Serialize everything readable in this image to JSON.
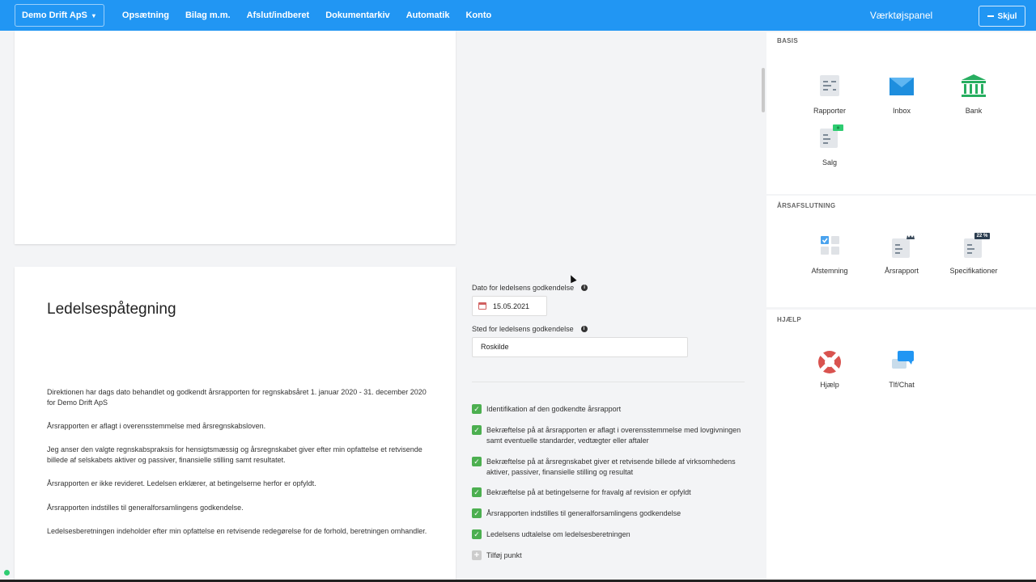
{
  "nav": {
    "company": "Demo Drift ApS",
    "items": [
      "Opsætning",
      "Bilag m.m.",
      "Afslut/indberet",
      "Dokumentarkiv",
      "Automatik",
      "Konto"
    ]
  },
  "toolpanel": {
    "title": "Værktøjspanel",
    "hide_label": "Skjul",
    "basis": {
      "title": "BASIS",
      "tiles": [
        "Rapporter",
        "Inbox",
        "Bank",
        "Salg"
      ]
    },
    "aarsafslutning": {
      "title": "ÅRSAFSLUTNING",
      "tiles": [
        "Afstemning",
        "Årsrapport",
        "Specifikationer"
      ],
      "badge": "22 %"
    },
    "hjaelp": {
      "title": "HJÆLP",
      "tiles": [
        "Hjælp",
        "Tlf/Chat"
      ]
    }
  },
  "document": {
    "title": "Ledelsespåtegning",
    "paragraphs": [
      "Direktionen har dags dato behandlet og godkendt årsrapporten for regnskabsåret 1. januar 2020 - 31. december 2020 for Demo Drift ApS",
      "Årsrapporten er aflagt i overensstemmelse med årsregnskabsloven.",
      "Jeg anser den valgte regnskabspraksis for hensigtsmæssig og årsregnskabet giver efter min opfattelse et retvisende billede af selskabets aktiver og passiver, finansielle stilling samt resultatet.",
      "Årsrapporten er ikke revideret. Ledelsen erklærer, at betingelserne herfor er opfyldt.",
      "Årsrapporten indstilles til generalforsamlingens godkendelse.",
      "Ledelsesberetningen indeholder efter min opfattelse en retvisende redegørelse for de forhold, beretningen omhandler."
    ]
  },
  "form": {
    "date_label": "Dato for ledelsens godkendelse",
    "date_value": "15.05.2021",
    "place_label": "Sted for ledelsens godkendelse",
    "place_value": "Roskilde",
    "checklist": [
      "Identifikation af den godkendte årsrapport",
      "Bekræftelse på at årsrapporten er aflagt i overensstemmelse med lovgivningen samt eventuelle standarder, vedtægter eller aftaler",
      "Bekræftelse på at årsregnskabet giver et retvisende billede af virksomhedens aktiver, passiver, finansielle stilling og resultat",
      "Bekræftelse på at betingelserne for fravalg af revision er opfyldt",
      "Årsrapporten indstilles til generalforsamlingens godkendelse",
      "Ledelsens udtalelse om ledelsesberetningen"
    ],
    "add_label": "Tilføj punkt"
  },
  "colors": {
    "primary": "#2196f3",
    "check": "#4caf50",
    "help_red": "#d9534f"
  }
}
